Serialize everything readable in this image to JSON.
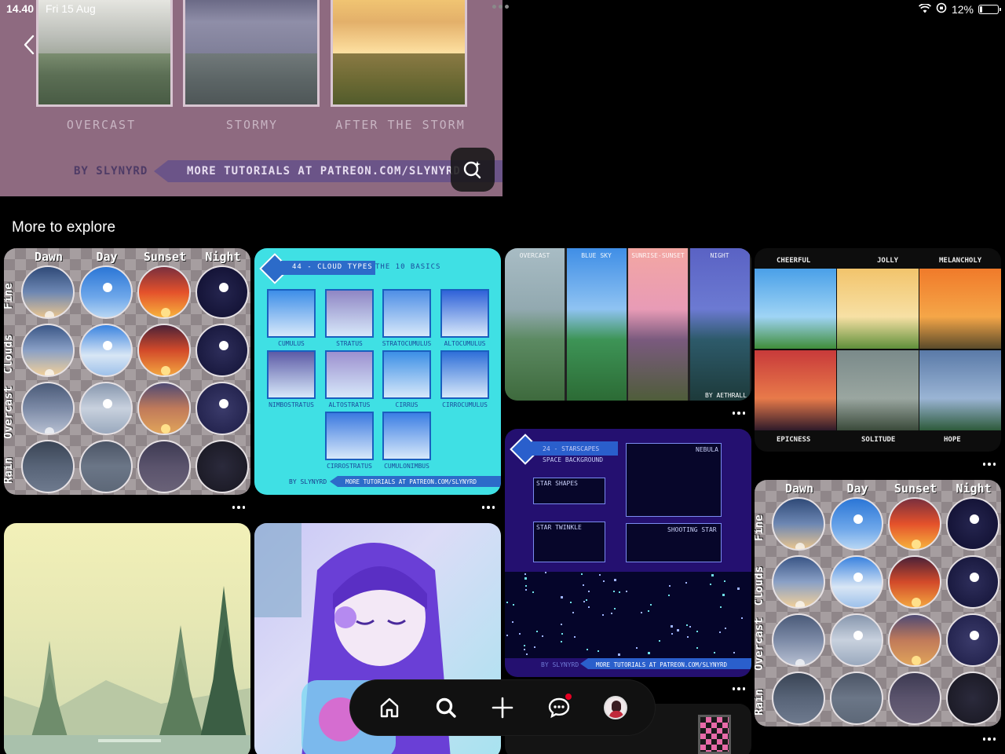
{
  "status_bar": {
    "time": "14.40",
    "date": "Fri 15 Aug",
    "battery": "12%",
    "battery_level": 0.12
  },
  "hero_pin": {
    "captions": [
      "OVERCAST",
      "STORMY",
      "AFTER THE STORM"
    ],
    "credit": "BY SLYNYRD",
    "banner_text": "MORE TUTORIALS AT PATREON.COM/SLYNYRD"
  },
  "section": {
    "title": "More to explore"
  },
  "sky_grid": {
    "columns": [
      "Dawn",
      "Day",
      "Sunset",
      "Night"
    ],
    "rows": [
      "Fine",
      "Clouds",
      "Overcast",
      "Rain"
    ]
  },
  "cloud_types": {
    "title": "44 - CLOUD TYPES",
    "subtitle": "THE 10 BASICS",
    "tiles": [
      "CUMULUS",
      "STRATUS",
      "STRATOCUMULUS",
      "ALTOCUMULUS",
      "NIMBOSTRATUS",
      "ALTOSTRATUS",
      "CIRRUS",
      "CIRROCUMULUS",
      "CIRROSTRATUS",
      "CUMULONIMBUS"
    ],
    "credit": "BY SLYNYRD",
    "footer": "MORE TUTORIALS AT PATREON.COM/SLYNYRD"
  },
  "landscape_pin": {
    "columns": [
      "OVERCAST",
      "BLUE SKY",
      "SUNRISE-SUNSET",
      "NIGHT"
    ],
    "credit": "BY AETHRALL"
  },
  "moods_pin": {
    "top_labels": [
      "CHEERFUL",
      "JOLLY",
      "MELANCHOLY"
    ],
    "bottom_labels": [
      "EPICNESS",
      "SOLITUDE",
      "HOPE"
    ]
  },
  "starscapes": {
    "title": "24 - STARSCAPES",
    "subtitle": "SPACE BACKGROUND",
    "labels": [
      "NEBULA",
      "STAR SHAPES",
      "STAR TWINKLE",
      "SHOOTING STAR"
    ],
    "credit": "BY SLYNYRD",
    "footer": "MORE TUTORIALS AT PATREON.COM/SLYNYRD"
  },
  "bottom_nav": {
    "items": [
      "home-icon",
      "search-icon",
      "plus-icon",
      "messages-icon",
      "profile-avatar"
    ]
  },
  "colors": {
    "accent": "#e60023",
    "background": "#000000",
    "hero_bg": "#8e6a80"
  }
}
